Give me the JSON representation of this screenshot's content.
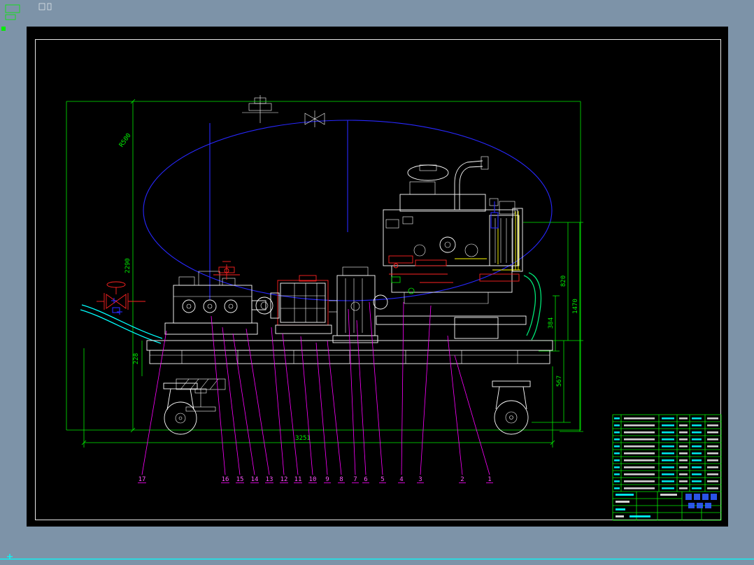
{
  "window": {
    "type": "cad-drawing-viewer",
    "frame_color": "#7d93a8",
    "canvas_color": "#000000",
    "status_line_color": "#00ffff"
  },
  "drawing": {
    "dims": {
      "overall_height": "2290",
      "overall_length": "3251",
      "base_height": "228",
      "engine_height": "820",
      "right_overall": "1470",
      "dim_a": "384",
      "dim_b": "567",
      "tank_radius": "R500"
    },
    "balloons": [
      "17",
      "16",
      "15",
      "14",
      "13",
      "12",
      "11",
      "10",
      "9",
      "8",
      "7",
      "6",
      "5",
      "4",
      "3",
      "2",
      "1"
    ]
  }
}
